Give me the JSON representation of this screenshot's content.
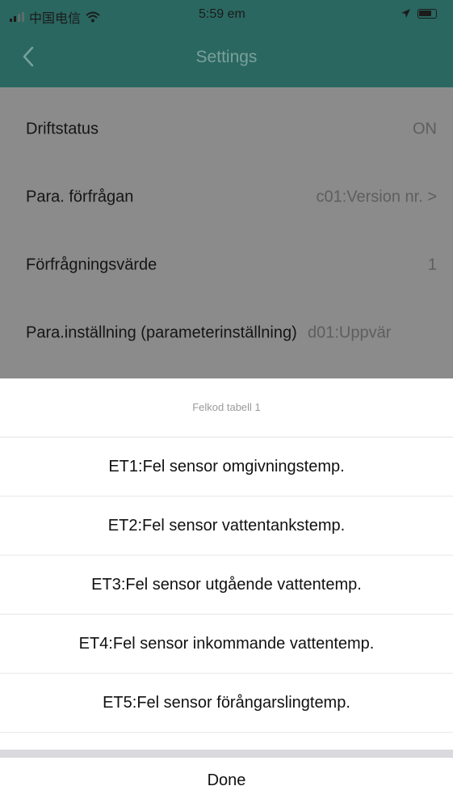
{
  "status_bar": {
    "carrier": "中国电信",
    "time": "5:59 em"
  },
  "nav": {
    "title": "Settings"
  },
  "settings": {
    "rows": [
      {
        "label": "Driftstatus",
        "value": "ON"
      },
      {
        "label": "Para. förfrågan",
        "value": "c01:Version nr. >"
      },
      {
        "label": "Förfrågningsvärde",
        "value": "1"
      },
      {
        "label": "Para.inställning (parameterinställning)",
        "value": "d01:Uppvär"
      }
    ]
  },
  "sheet": {
    "title": "Felkod tabell 1",
    "options": [
      "ET1:Fel sensor omgivningstemp.",
      "ET2:Fel sensor vattentankstemp.",
      "ET3:Fel sensor utgående vattentemp.",
      "ET4:Fel sensor inkommande vattentemp.",
      "ET5:Fel sensor förångarslingtemp."
    ],
    "done_label": "Done"
  }
}
